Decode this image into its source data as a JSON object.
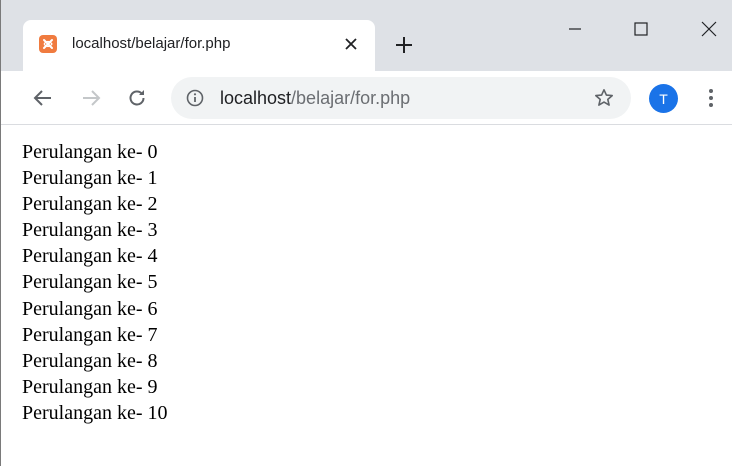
{
  "tab": {
    "title": "localhost/belajar/for.php",
    "favicon": "xampp-icon",
    "close_glyph": "✕"
  },
  "newtab": {
    "icon": "plus-icon"
  },
  "window_controls": {
    "minimize": "minimize-icon",
    "maximize": "maximize-icon",
    "close": "close-icon"
  },
  "toolbar": {
    "back": "back-arrow-icon",
    "forward": "forward-arrow-icon",
    "reload": "reload-icon",
    "url_host": "localhost",
    "url_path": "/belajar/for.php",
    "star": "bookmark-star-icon",
    "avatar_letter": "T",
    "menu": "kebab-menu-icon"
  },
  "colors": {
    "tabstrip": "#dee1e6",
    "omnibox": "#f1f3f4",
    "avatar": "#1a73e8",
    "favicon": "#f07b3f"
  },
  "page": {
    "lines": [
      "Perulangan ke- 0",
      "Perulangan ke- 1",
      "Perulangan ke- 2",
      "Perulangan ke- 3",
      "Perulangan ke- 4",
      "Perulangan ke- 5",
      "Perulangan ke- 6",
      "Perulangan ke- 7",
      "Perulangan ke- 8",
      "Perulangan ke- 9",
      "Perulangan ke- 10"
    ]
  }
}
